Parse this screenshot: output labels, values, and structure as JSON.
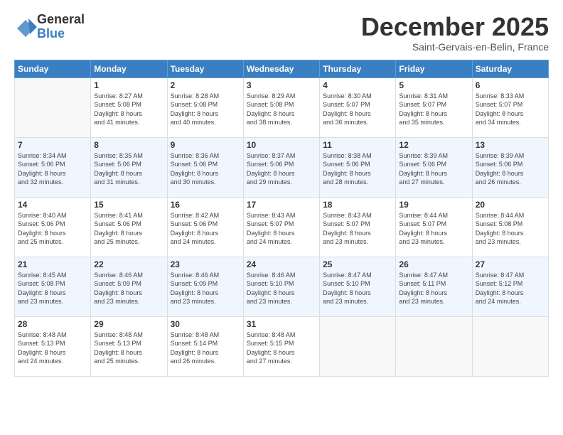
{
  "logo": {
    "line1": "General",
    "line2": "Blue"
  },
  "title": "December 2025",
  "location": "Saint-Gervais-en-Belin, France",
  "headers": [
    "Sunday",
    "Monday",
    "Tuesday",
    "Wednesday",
    "Thursday",
    "Friday",
    "Saturday"
  ],
  "weeks": [
    [
      {
        "day": "",
        "info": ""
      },
      {
        "day": "1",
        "info": "Sunrise: 8:27 AM\nSunset: 5:08 PM\nDaylight: 8 hours\nand 41 minutes."
      },
      {
        "day": "2",
        "info": "Sunrise: 8:28 AM\nSunset: 5:08 PM\nDaylight: 8 hours\nand 40 minutes."
      },
      {
        "day": "3",
        "info": "Sunrise: 8:29 AM\nSunset: 5:08 PM\nDaylight: 8 hours\nand 38 minutes."
      },
      {
        "day": "4",
        "info": "Sunrise: 8:30 AM\nSunset: 5:07 PM\nDaylight: 8 hours\nand 36 minutes."
      },
      {
        "day": "5",
        "info": "Sunrise: 8:31 AM\nSunset: 5:07 PM\nDaylight: 8 hours\nand 35 minutes."
      },
      {
        "day": "6",
        "info": "Sunrise: 8:33 AM\nSunset: 5:07 PM\nDaylight: 8 hours\nand 34 minutes."
      }
    ],
    [
      {
        "day": "7",
        "info": "Sunrise: 8:34 AM\nSunset: 5:06 PM\nDaylight: 8 hours\nand 32 minutes."
      },
      {
        "day": "8",
        "info": "Sunrise: 8:35 AM\nSunset: 5:06 PM\nDaylight: 8 hours\nand 31 minutes."
      },
      {
        "day": "9",
        "info": "Sunrise: 8:36 AM\nSunset: 5:06 PM\nDaylight: 8 hours\nand 30 minutes."
      },
      {
        "day": "10",
        "info": "Sunrise: 8:37 AM\nSunset: 5:06 PM\nDaylight: 8 hours\nand 29 minutes."
      },
      {
        "day": "11",
        "info": "Sunrise: 8:38 AM\nSunset: 5:06 PM\nDaylight: 8 hours\nand 28 minutes."
      },
      {
        "day": "12",
        "info": "Sunrise: 8:39 AM\nSunset: 5:06 PM\nDaylight: 8 hours\nand 27 minutes."
      },
      {
        "day": "13",
        "info": "Sunrise: 8:39 AM\nSunset: 5:06 PM\nDaylight: 8 hours\nand 26 minutes."
      }
    ],
    [
      {
        "day": "14",
        "info": "Sunrise: 8:40 AM\nSunset: 5:06 PM\nDaylight: 8 hours\nand 25 minutes."
      },
      {
        "day": "15",
        "info": "Sunrise: 8:41 AM\nSunset: 5:06 PM\nDaylight: 8 hours\nand 25 minutes."
      },
      {
        "day": "16",
        "info": "Sunrise: 8:42 AM\nSunset: 5:06 PM\nDaylight: 8 hours\nand 24 minutes."
      },
      {
        "day": "17",
        "info": "Sunrise: 8:43 AM\nSunset: 5:07 PM\nDaylight: 8 hours\nand 24 minutes."
      },
      {
        "day": "18",
        "info": "Sunrise: 8:43 AM\nSunset: 5:07 PM\nDaylight: 8 hours\nand 23 minutes."
      },
      {
        "day": "19",
        "info": "Sunrise: 8:44 AM\nSunset: 5:07 PM\nDaylight: 8 hours\nand 23 minutes."
      },
      {
        "day": "20",
        "info": "Sunrise: 8:44 AM\nSunset: 5:08 PM\nDaylight: 8 hours\nand 23 minutes."
      }
    ],
    [
      {
        "day": "21",
        "info": "Sunrise: 8:45 AM\nSunset: 5:08 PM\nDaylight: 8 hours\nand 23 minutes."
      },
      {
        "day": "22",
        "info": "Sunrise: 8:46 AM\nSunset: 5:09 PM\nDaylight: 8 hours\nand 23 minutes."
      },
      {
        "day": "23",
        "info": "Sunrise: 8:46 AM\nSunset: 5:09 PM\nDaylight: 8 hours\nand 23 minutes."
      },
      {
        "day": "24",
        "info": "Sunrise: 8:46 AM\nSunset: 5:10 PM\nDaylight: 8 hours\nand 23 minutes."
      },
      {
        "day": "25",
        "info": "Sunrise: 8:47 AM\nSunset: 5:10 PM\nDaylight: 8 hours\nand 23 minutes."
      },
      {
        "day": "26",
        "info": "Sunrise: 8:47 AM\nSunset: 5:11 PM\nDaylight: 8 hours\nand 23 minutes."
      },
      {
        "day": "27",
        "info": "Sunrise: 8:47 AM\nSunset: 5:12 PM\nDaylight: 8 hours\nand 24 minutes."
      }
    ],
    [
      {
        "day": "28",
        "info": "Sunrise: 8:48 AM\nSunset: 5:13 PM\nDaylight: 8 hours\nand 24 minutes."
      },
      {
        "day": "29",
        "info": "Sunrise: 8:48 AM\nSunset: 5:13 PM\nDaylight: 8 hours\nand 25 minutes."
      },
      {
        "day": "30",
        "info": "Sunrise: 8:48 AM\nSunset: 5:14 PM\nDaylight: 8 hours\nand 26 minutes."
      },
      {
        "day": "31",
        "info": "Sunrise: 8:48 AM\nSunset: 5:15 PM\nDaylight: 8 hours\nand 27 minutes."
      },
      {
        "day": "",
        "info": ""
      },
      {
        "day": "",
        "info": ""
      },
      {
        "day": "",
        "info": ""
      }
    ]
  ]
}
